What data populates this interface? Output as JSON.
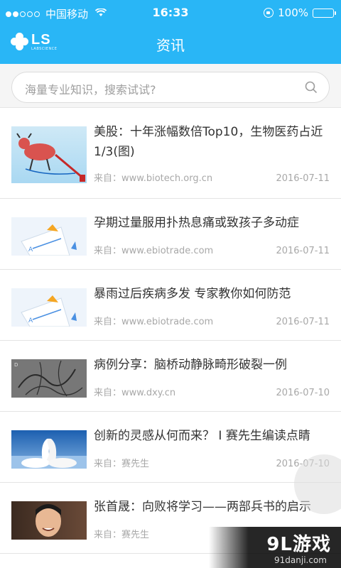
{
  "status_bar": {
    "carrier": "中国移动",
    "time": "16:33",
    "battery": "100%",
    "battery_level": 1.0
  },
  "navbar": {
    "logo_text": "LS",
    "logo_subtext": "LABSCIENCE",
    "title": "资讯"
  },
  "search": {
    "placeholder": "海量专业知识，搜索试试?"
  },
  "articles": [
    {
      "title": "美股：十年涨幅数倍Top10，生物医药占近1/3(图)",
      "source": "来自：www.biotech.org.cn",
      "date": "2016-07-11",
      "thumb_icon": "bull-cartoon-thumbnail"
    },
    {
      "title": "孕期过量服用扑热息痛或致孩子多动症",
      "source": "来自：www.ebiotrade.com",
      "date": "2016-07-11",
      "thumb_icon": "document-placeholder-thumbnail"
    },
    {
      "title": "暴雨过后疾病多发 专家教你如何防范",
      "source": "来自：www.ebiotrade.com",
      "date": "2016-07-11",
      "thumb_icon": "document-placeholder-thumbnail"
    },
    {
      "title": "病例分享：脑桥动静脉畸形破裂一例",
      "source": "来自：www.dxy.cn",
      "date": "2016-07-10",
      "thumb_icon": "angiogram-thumbnail"
    },
    {
      "title": "创新的灵感从何而来？ I 赛先生编读点睛",
      "source": "来自：赛先生",
      "date": "2016-07-10",
      "thumb_icon": "swans-thumbnail"
    },
    {
      "title": "张首晟：向败将学习——两部兵书的启示",
      "source": "来自：赛先生",
      "date": "",
      "thumb_icon": "portrait-thumbnail"
    }
  ],
  "watermark": {
    "main": "9L游戏",
    "sub": "91danji.com"
  },
  "colors": {
    "header": "#29b6f6",
    "text": "#333333",
    "meta": "#a8a8a8"
  }
}
